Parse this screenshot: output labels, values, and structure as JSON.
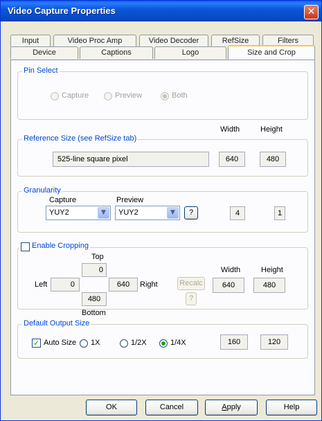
{
  "window": {
    "title": "Video Capture Properties",
    "close_glyph": "✕"
  },
  "tabs": {
    "row1": [
      "Input",
      "Video Proc Amp",
      "Video Decoder",
      "RefSize",
      "Filters"
    ],
    "row2": [
      "Device",
      "Captions",
      "Logo",
      "Size and Crop"
    ],
    "active": "Size and Crop"
  },
  "pin_select": {
    "legend": "Pin Select",
    "options": [
      "Capture",
      "Preview",
      "Both"
    ],
    "selected": "Both"
  },
  "reference_size": {
    "legend": "Reference Size  (see RefSize tab)",
    "col_width": "Width",
    "col_height": "Height",
    "value": "525-line square pixel",
    "width": "640",
    "height": "480"
  },
  "granularity": {
    "legend": "Granularity",
    "capture_label": "Capture",
    "preview_label": "Preview",
    "capture_value": "YUY2",
    "preview_value": "YUY2",
    "help_button": "?",
    "width": "4",
    "height": "1"
  },
  "cropping": {
    "legend": "Enable Cropping",
    "checked": false,
    "top_label": "Top",
    "top": "0",
    "left_label": "Left",
    "left": "0",
    "bottom_value": "480",
    "right_value": "640",
    "right_label": "Right",
    "bottom_label": "Bottom",
    "recalc_button": "Recalc",
    "help_button": "?",
    "col_width": "Width",
    "col_height": "Height",
    "width": "640",
    "height": "480"
  },
  "output": {
    "legend": "Default Output Size",
    "auto_size_label": "Auto Size",
    "auto_size_checked": true,
    "options": [
      "1X",
      "1/2X",
      "1/4X"
    ],
    "selected": "1/4X",
    "width": "160",
    "height": "120"
  },
  "buttons": {
    "ok": "OK",
    "cancel": "Cancel",
    "apply_prefix": "A",
    "apply_rest": "pply",
    "help": "Help"
  },
  "colors": {
    "titlebar": "#0b58d8",
    "legend_text": "#0046d5",
    "radio_selected": "#21a121"
  }
}
